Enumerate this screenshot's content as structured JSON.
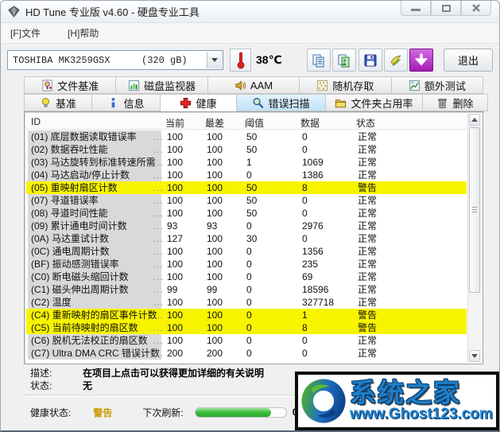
{
  "window": {
    "title": "HD Tune 专业版 v4.60 - 硬盘专业工具"
  },
  "menu": {
    "items": [
      {
        "label": "[F]文件"
      },
      {
        "label": "[H]帮助"
      }
    ]
  },
  "toolbar": {
    "drive_name": "TOSHIBA MK3259GSX",
    "drive_capacity": "(320 gB)",
    "temperature": "38℃",
    "exit_label": "退出"
  },
  "tabs_row1": [
    {
      "label": "文件基准"
    },
    {
      "label": "磁盘监视器"
    },
    {
      "label": "AAM"
    },
    {
      "label": "随机存取"
    },
    {
      "label": "额外测试"
    }
  ],
  "tabs_row2": [
    {
      "label": "基准"
    },
    {
      "label": "信息"
    },
    {
      "label": "健康"
    },
    {
      "label": "错误扫描"
    },
    {
      "label": "文件夹占用率"
    },
    {
      "label": "删除"
    }
  ],
  "table": {
    "columns": [
      "ID",
      "当前",
      "最差",
      "阈值",
      "数据",
      "状态"
    ],
    "ellipsis": "...",
    "rows": [
      {
        "id": "(01)",
        "name": "底层数据读取错误率",
        "current": "100",
        "worst": "100",
        "threshold": "50",
        "data": "0",
        "status": "正常",
        "warning": false
      },
      {
        "id": "(02)",
        "name": "数据吞吐性能",
        "current": "100",
        "worst": "100",
        "threshold": "50",
        "data": "0",
        "status": "正常",
        "warning": false
      },
      {
        "id": "(03)",
        "name": "马达旋转到标准转速所需",
        "current": "100",
        "worst": "100",
        "threshold": "1",
        "data": "1069",
        "status": "正常",
        "warning": false
      },
      {
        "id": "(04)",
        "name": "马达启动/停止计数",
        "current": "100",
        "worst": "100",
        "threshold": "0",
        "data": "1386",
        "status": "正常",
        "warning": false
      },
      {
        "id": "(05)",
        "name": "重映射扇区计数",
        "current": "100",
        "worst": "100",
        "threshold": "50",
        "data": "8",
        "status": "警告",
        "warning": true
      },
      {
        "id": "(07)",
        "name": "寻道错误率",
        "current": "100",
        "worst": "100",
        "threshold": "50",
        "data": "0",
        "status": "正常",
        "warning": false
      },
      {
        "id": "(08)",
        "name": "寻道时间性能",
        "current": "100",
        "worst": "100",
        "threshold": "50",
        "data": "0",
        "status": "正常",
        "warning": false
      },
      {
        "id": "(09)",
        "name": "累计通电时间计数",
        "current": "93",
        "worst": "93",
        "threshold": "0",
        "data": "2976",
        "status": "正常",
        "warning": false
      },
      {
        "id": "(0A)",
        "name": "马达重试计数",
        "current": "127",
        "worst": "100",
        "threshold": "30",
        "data": "0",
        "status": "正常",
        "warning": false
      },
      {
        "id": "(0C)",
        "name": "通电周期计数",
        "current": "100",
        "worst": "100",
        "threshold": "0",
        "data": "1356",
        "status": "正常",
        "warning": false
      },
      {
        "id": "(BF)",
        "name": "振动感测错误率",
        "current": "100",
        "worst": "100",
        "threshold": "0",
        "data": "235",
        "status": "正常",
        "warning": false
      },
      {
        "id": "(C0)",
        "name": "断电磁头缩回计数",
        "current": "100",
        "worst": "100",
        "threshold": "0",
        "data": "69",
        "status": "正常",
        "warning": false
      },
      {
        "id": "(C1)",
        "name": "磁头伸出周期计数",
        "current": "99",
        "worst": "99",
        "threshold": "0",
        "data": "18596",
        "status": "正常",
        "warning": false
      },
      {
        "id": "(C2)",
        "name": "温度",
        "current": "100",
        "worst": "100",
        "threshold": "0",
        "data": "327718",
        "status": "正常",
        "warning": false
      },
      {
        "id": "(C4)",
        "name": "重新映射的扇区事件计数",
        "current": "100",
        "worst": "100",
        "threshold": "0",
        "data": "1",
        "status": "警告",
        "warning": true
      },
      {
        "id": "(C5)",
        "name": "当前待映射的扇区数",
        "current": "100",
        "worst": "100",
        "threshold": "0",
        "data": "8",
        "status": "警告",
        "warning": true
      },
      {
        "id": "(C6)",
        "name": "脱机无法校正的扇区数",
        "current": "100",
        "worst": "100",
        "threshold": "0",
        "data": "0",
        "status": "正常",
        "warning": false
      },
      {
        "id": "(C7)",
        "name": "Ultra DMA CRC 错误计数",
        "current": "200",
        "worst": "200",
        "threshold": "0",
        "data": "0",
        "status": "正常",
        "warning": false
      }
    ]
  },
  "details": {
    "desc_label": "描述:",
    "desc_value": "在项目上点击可以获得更加详细的有关说明",
    "status_label": "状态:",
    "status_value": "无"
  },
  "statusbar": {
    "health_label": "健康状态:",
    "health_value": "警告",
    "refresh_label": "下次刷新:",
    "refresh_time": "0:",
    "progress_percent": 84
  },
  "watermark": {
    "title": "系统之家",
    "url": "www.Ghost123.com"
  },
  "colors": {
    "warning_row": "#f8f400",
    "warning_text": "#cc9a00",
    "tab_highlight": "#bfe2f6",
    "progress_green": "#3fbf3f",
    "logo_blue": "#1e7ec8"
  }
}
